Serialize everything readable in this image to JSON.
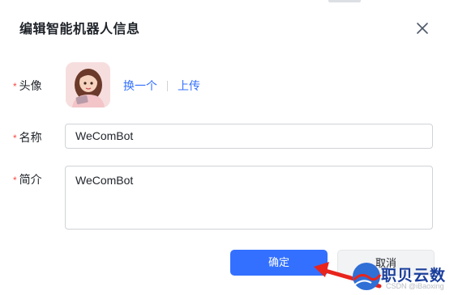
{
  "dialog": {
    "title": "编辑智能机器人信息",
    "close_icon": "close-icon"
  },
  "form": {
    "avatar": {
      "label": "头像",
      "change_label": "换一个",
      "upload_label": "上传"
    },
    "name": {
      "label": "名称",
      "value": "WeComBot"
    },
    "intro": {
      "label": "简介",
      "value": "WeComBot"
    },
    "required_mark": "*"
  },
  "footer": {
    "confirm_label": "确定",
    "cancel_label": "取消"
  },
  "watermark": {
    "brand": "职贝云数",
    "sub": "CSDN @iBaoxing"
  },
  "colors": {
    "primary": "#3370ff",
    "required": "#f54a45",
    "arrow": "#e8241c"
  }
}
